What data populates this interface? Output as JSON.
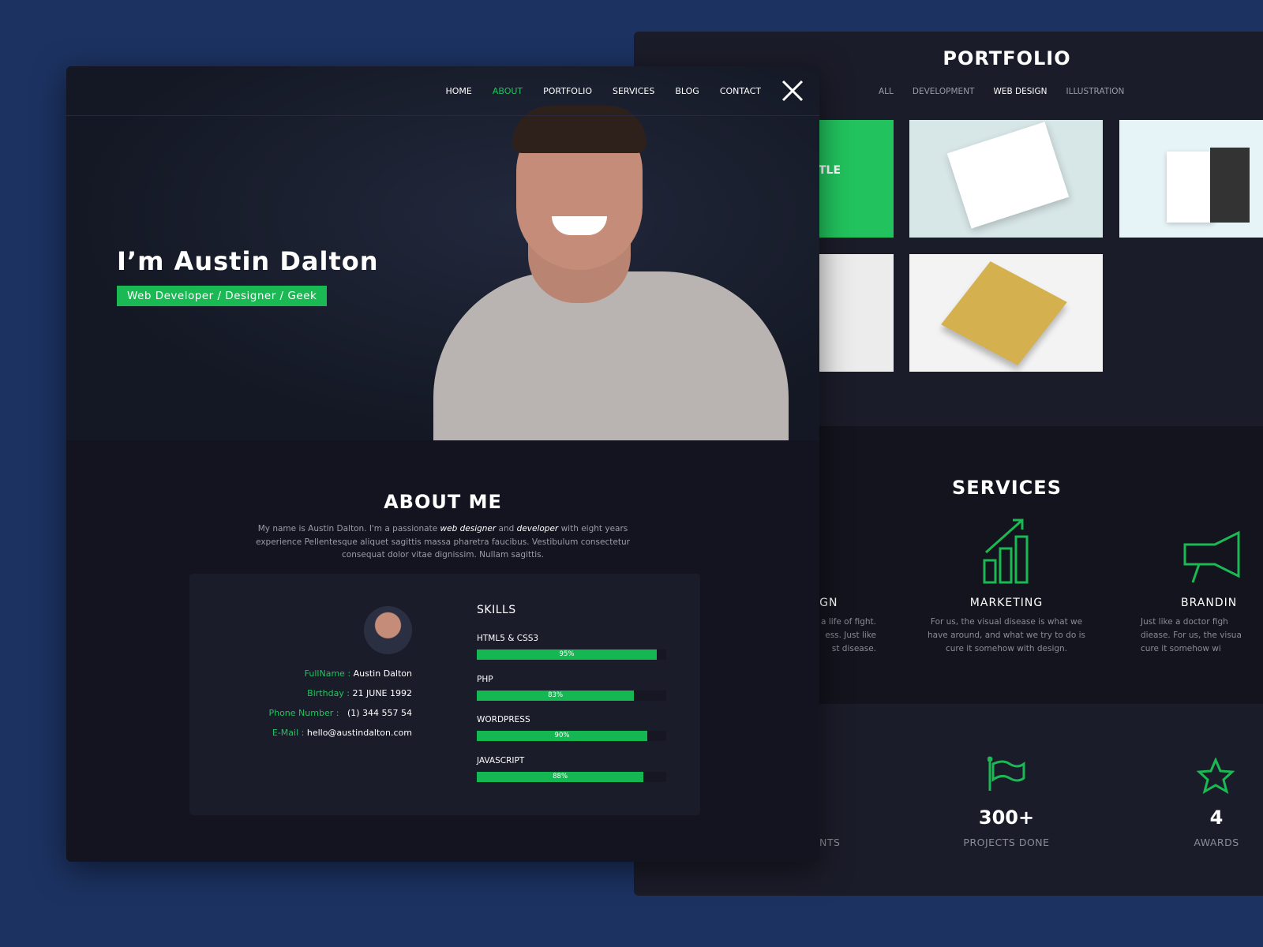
{
  "portfolio": {
    "title": "PORTFOLIO",
    "filters": [
      {
        "label": "ALL",
        "active": false
      },
      {
        "label": "DEVELOPMENT",
        "active": false
      },
      {
        "label": "WEB DESIGN",
        "active": true
      },
      {
        "label": "ILLUSTRATION",
        "active": false
      }
    ],
    "thumb_title_fragment": "TLE"
  },
  "services": {
    "title": "SERVICES",
    "items": [
      {
        "title": "IGN",
        "text": "a life of fight.\ness. Just like\nst disease.",
        "icon": "design-icon"
      },
      {
        "title": "MARKETING",
        "text": "For us, the visual disease is what we have around, and what we try to do is cure it somehow with design.",
        "icon": "bar-chart-arrow-icon"
      },
      {
        "title": "BRANDIN",
        "text": "Just like a doctor figh\ndiease. For us, the visua\ncure it somehow wi",
        "icon": "megaphone-icon"
      }
    ]
  },
  "stats": [
    {
      "value": "",
      "label": "NTS",
      "icon": ""
    },
    {
      "value": "300+",
      "label": "PROJECTS DONE",
      "icon": "flag-icon"
    },
    {
      "value": "4",
      "label": "AWARDS",
      "icon": "star-icon"
    }
  ],
  "nav": {
    "items": [
      {
        "label": "HOME",
        "active": false
      },
      {
        "label": "ABOUT",
        "active": true
      },
      {
        "label": "PORTFOLIO",
        "active": false
      },
      {
        "label": "SERVICES",
        "active": false
      },
      {
        "label": "BLOG",
        "active": false
      },
      {
        "label": "CONTACT",
        "active": false
      }
    ]
  },
  "hero": {
    "title": "I’m Austin Dalton",
    "tagline": "Web Developer / Designer / Geek"
  },
  "about": {
    "title": "ABOUT ME",
    "p1": "My name is Austin Dalton. I'm a passionate ",
    "em1": "web designer",
    "p2": " and ",
    "em2": "developer",
    "p3": " with eight years experience Pellentesque aliquet sagittis massa pharetra faucibus. Vestibulum consectetur consequat dolor vitae dignissim. Nullam sagittis."
  },
  "info": [
    {
      "label": "FullName :",
      "value": "Austin Dalton"
    },
    {
      "label": "Birthday :",
      "value": "21 JUNE 1992"
    },
    {
      "label": "Phone Number :",
      "value": "(1) 344 557 54"
    },
    {
      "label": "E-Mail :",
      "value": "hello@austindalton.com"
    }
  ],
  "skills": {
    "title": "SKILLS",
    "items": [
      {
        "name": "HTML5 & CSS3",
        "percent": 95,
        "label": "95%"
      },
      {
        "name": "PHP",
        "percent": 83,
        "label": "83%"
      },
      {
        "name": "WORDPRESS",
        "percent": 90,
        "label": "90%"
      },
      {
        "name": "JAVASCRIPT",
        "percent": 88,
        "label": "88%"
      }
    ]
  },
  "colors": {
    "accent": "#1ab954",
    "background": "#1c3261",
    "panel": "#13141f"
  }
}
